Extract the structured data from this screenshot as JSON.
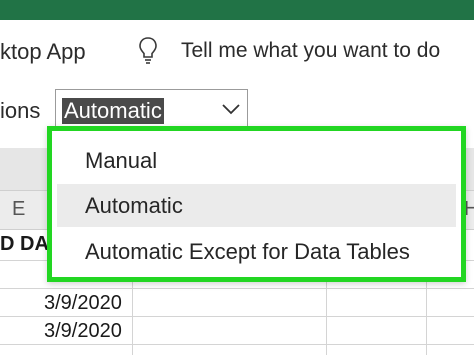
{
  "ribbon": {
    "desktop_app": "ktop App",
    "tell_me": "Tell me what you want to do",
    "options_label": "ions"
  },
  "calculation": {
    "selected": "Automatic"
  },
  "grid": {
    "column_e": "E",
    "column_h": "H",
    "header_cell": "D DAT",
    "dates": [
      "3/9/2020",
      "3/9/2020"
    ]
  },
  "dropdown": {
    "items": [
      {
        "label": "Manual"
      },
      {
        "label": "Automatic"
      },
      {
        "label": "Automatic Except for Data Tables"
      }
    ]
  },
  "colors": {
    "excel_green": "#217346",
    "highlight_green": "#22d622"
  },
  "icons": {
    "bulb": "lightbulb-icon",
    "chevron": "chevron-down-icon"
  }
}
